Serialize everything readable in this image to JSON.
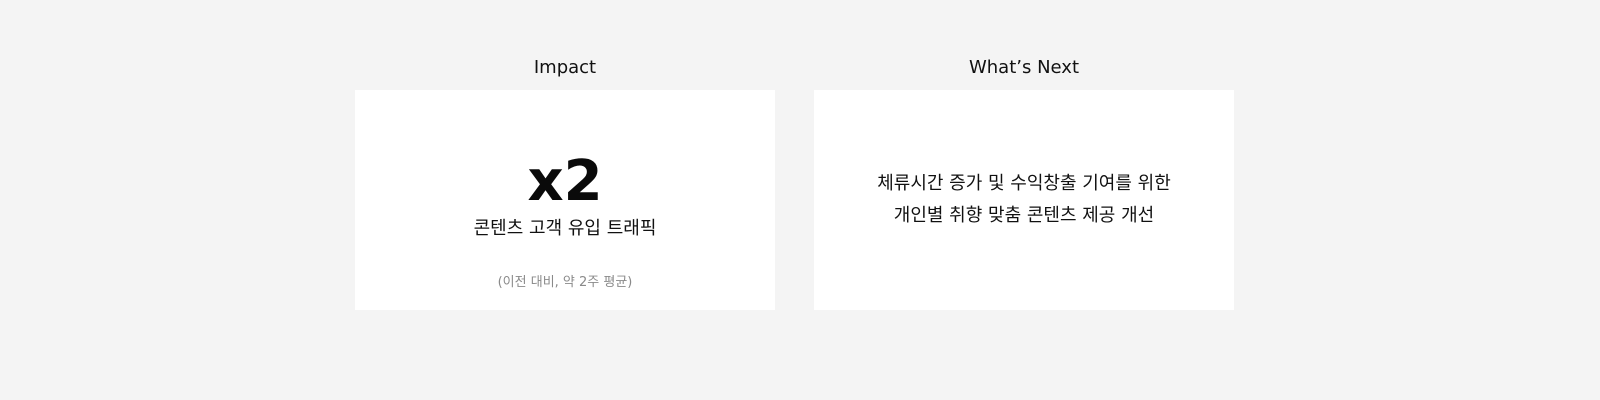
{
  "impact": {
    "heading": "Impact",
    "metric_value": "x2",
    "metric_label": "콘텐츠 고객 유입 트래픽",
    "metric_note": "(이전 대비, 약 2주 평균)"
  },
  "whats_next": {
    "heading": "What’s Next",
    "lines": [
      "체류시간 증가 및 수익창출 기여를 위한",
      "개인별 취향 맞춤 콘텐츠 제공 개선"
    ]
  },
  "colors": {
    "background": "#f4f4f4",
    "card": "#ffffff",
    "text": "#111111",
    "muted": "#8a8a8a"
  }
}
